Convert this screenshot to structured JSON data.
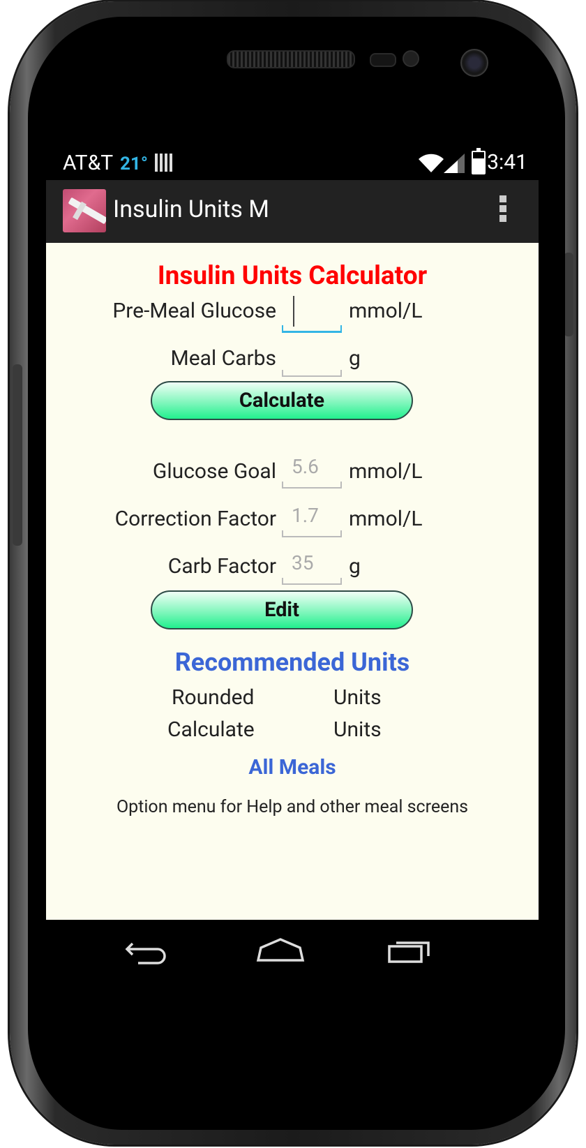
{
  "status_bar": {
    "carrier": "AT&T",
    "temperature": "21°",
    "time": "3:41",
    "icons": [
      "sim-card-icon",
      "wifi-icon",
      "cell-signal-icon",
      "battery-charging-icon"
    ]
  },
  "action_bar": {
    "title": "Insulin Units M",
    "app_icon": "syringe-icon",
    "menu_icon": "overflow-menu-icon"
  },
  "calculator": {
    "heading": "Insulin Units Calculator",
    "pre_meal_glucose": {
      "label": "Pre-Meal Glucose",
      "value": "",
      "unit": "mmol/L"
    },
    "meal_carbs": {
      "label": "Meal Carbs",
      "value": "",
      "unit": "g"
    },
    "calculate_button": "Calculate"
  },
  "settings": {
    "glucose_goal": {
      "label": "Glucose Goal",
      "value": "5.6",
      "unit": "mmol/L"
    },
    "correction_factor": {
      "label": "Correction Factor",
      "value": "1.7",
      "unit": "mmol/L"
    },
    "carb_factor": {
      "label": "Carb Factor",
      "value": "35",
      "unit": "g"
    },
    "edit_button": "Edit"
  },
  "results": {
    "heading": "Recommended Units",
    "rounded_label": "Rounded",
    "rounded_unit": "Units",
    "calculated_label": "Calculate",
    "calculated_unit": "Units"
  },
  "footer": {
    "all_meals_link": "All Meals",
    "note": "Option menu for Help and other meal screens"
  },
  "nav_bar": {
    "icons": [
      "back-icon",
      "home-icon",
      "recent-apps-icon"
    ]
  },
  "colors": {
    "heading_red": "#ff0000",
    "heading_blue": "#3b66d6",
    "button_green": "#22f08e",
    "background": "#fdfdef",
    "focus_blue": "#33b5e5"
  }
}
